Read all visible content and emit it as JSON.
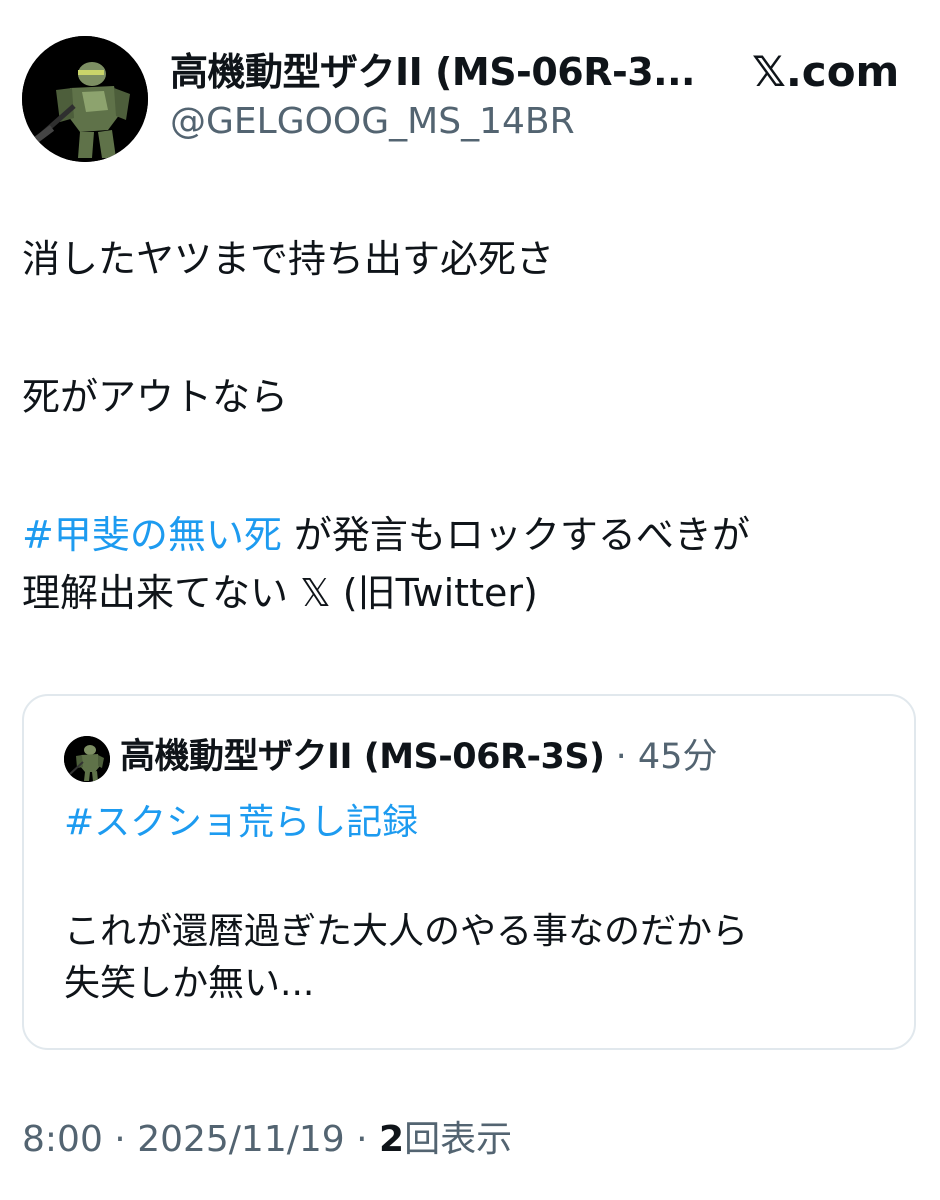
{
  "header": {
    "display_name": "高機動型ザクII (MS-06R-3...",
    "handle": "@GELGOOG_MS_14BR",
    "site_x": "𝕏",
    "site_domain": ".com",
    "avatar_icon": "green-mobile-suit-avatar"
  },
  "tweet": {
    "line1": "消したヤツまで持ち出す必死さ",
    "line2": "死がアウトなら",
    "hashtag": "#甲斐の無い死",
    "line3_rest": " が発言もロックするべきが",
    "line4_text": "理解出来てない ",
    "line4_x": "𝕏",
    "line4_tail": " (旧Twitter)"
  },
  "quote": {
    "avatar_icon": "green-mobile-suit-avatar",
    "name": "高機動型ザクII (MS-06R-3S)",
    "separator": " · ",
    "time": "45分",
    "hashtag": "#スクショ荒らし記録",
    "text_line1": "これが還暦過ぎた大人のやる事なのだから",
    "text_line2": "失笑しか無い..."
  },
  "footer": {
    "time": "8:00",
    "sep1": " · ",
    "date": "2025/11/19",
    "sep2": " · ",
    "views_count": "2",
    "views_label": "回表示"
  },
  "colors": {
    "link": "#1d9bf0",
    "text": "#0f1419",
    "muted": "#536471",
    "border": "#e1e8ed"
  }
}
